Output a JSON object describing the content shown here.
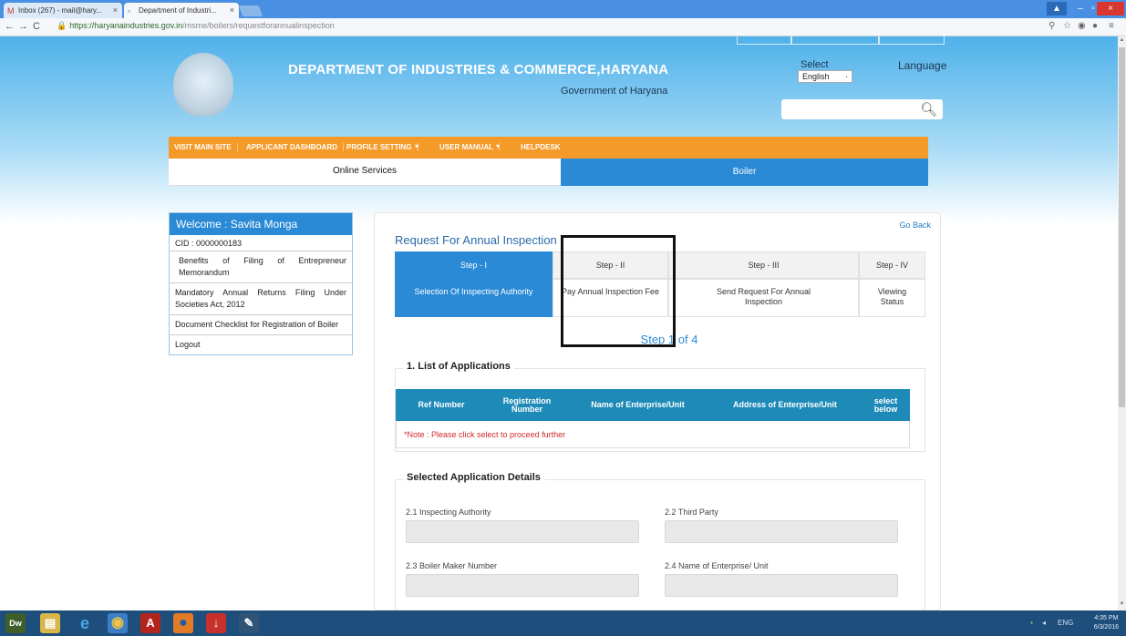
{
  "browser": {
    "tabs": [
      {
        "label": "Inbox (267) - mail@hary...",
        "icon": "gmail-icon"
      },
      {
        "label": "Department of Industri...",
        "icon": "page-icon"
      }
    ],
    "url_secure": "https://haryanaindustries.gov.in",
    "url_path": "/msme/boilers/requestforannualinspection"
  },
  "header": {
    "title": "DEPARTMENT OF INDUSTRIES & COMMERCE,HARYANA",
    "subtitle": "Government of Haryana",
    "select_label": "Select",
    "language_value": "English",
    "language_label": "Language"
  },
  "menu": {
    "items": [
      "VISIT MAIN SITE",
      "APPLICANT DASHBOARD",
      "PROFILE SETTING",
      "USER MANUAL",
      "HELPDESK"
    ]
  },
  "services": {
    "left": "Online Services",
    "right": "Boiler"
  },
  "sidebar": {
    "welcome": "Welcome : Savita Monga",
    "cid": "CID : 0000000183",
    "items": [
      "Benefits of Filing of Entrepreneur Memorandum",
      "Mandatory Annual Returns Filing Under Societies Act, 2012",
      "Document Checklist for Registration of Boiler",
      "Logout"
    ]
  },
  "main": {
    "go_back": "Go Back",
    "title": "Request For Annual Inspection",
    "steps": [
      {
        "head": "Step - I",
        "body": "Selection Of Inspecting Authority",
        "active": true
      },
      {
        "head": "Step - II",
        "body": "Pay Annual Inspection Fee",
        "active": false
      },
      {
        "head": "Step - III",
        "body": "Send Request For Annual Inspection",
        "active": false
      },
      {
        "head": "Step - IV",
        "body": "Viewing Status",
        "active": false
      }
    ],
    "step_of": "Step 1 of 4",
    "list_title": "1. List of Applications",
    "columns": [
      "Ref Number",
      "Registration Number",
      "Name of Enterprise/Unit",
      "Address of Enterprise/Unit",
      "select below"
    ],
    "note": "*Note : Please click select to proceed further",
    "details_title": "Selected Application Details",
    "fields": [
      {
        "label": "2.1 Inspecting Authority",
        "value": ""
      },
      {
        "label": "2.2 Third Party",
        "value": ""
      },
      {
        "label": "2.3 Boiler Maker Number",
        "value": ""
      },
      {
        "label": "2.4 Name of Enterprise/ Unit",
        "value": ""
      }
    ]
  },
  "taskbar": {
    "apps": [
      "Dw",
      "file-explorer",
      "internet-explorer",
      "chrome",
      "acrobat",
      "firefox",
      "downloader",
      "notepad"
    ],
    "tray_lang": "ENG",
    "time": "4:35 PM",
    "date": "6/3/2016"
  },
  "colors": {
    "accent_blue": "#2a8ad6",
    "menu_orange": "#f49a29",
    "table_head": "#1e8ab8",
    "note_red": "#d32a2a"
  }
}
